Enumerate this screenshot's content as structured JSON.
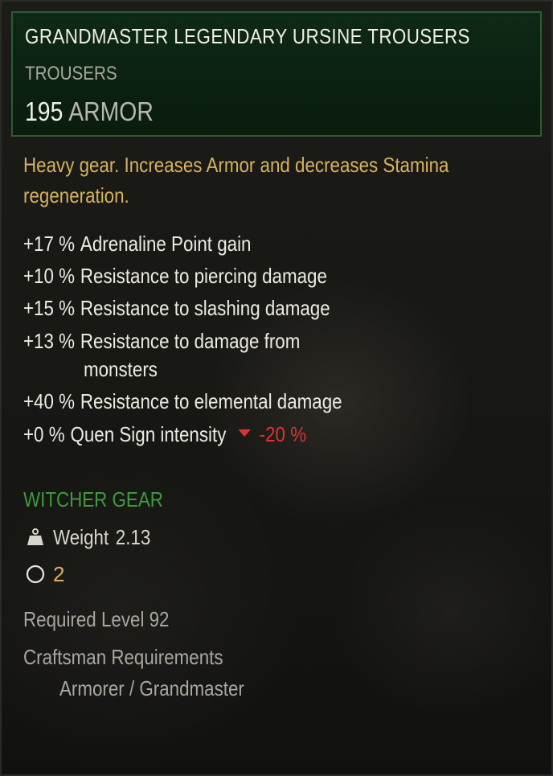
{
  "item": {
    "name": "GRANDMASTER LEGENDARY URSINE TROUSERS",
    "type": "TROUSERS",
    "armor_value": "195",
    "armor_label": "ARMOR"
  },
  "description": "Heavy gear. Increases Armor and decreases Stamina regeneration.",
  "stats": [
    {
      "pct": "+17 %",
      "label": "Adrenaline Point gain"
    },
    {
      "pct": "+10 %",
      "label": "Resistance to piercing damage"
    },
    {
      "pct": "+15 %",
      "label": "Resistance to slashing damage"
    },
    {
      "pct": "+13 %",
      "label": "Resistance to damage from",
      "continuation": "monsters"
    },
    {
      "pct": "+40 %",
      "label": "Resistance to elemental damage"
    },
    {
      "pct": "+0 %",
      "label": "Quen Sign intensity",
      "modifier": "-20 %",
      "modifier_icon": "red-down-triangle-icon"
    }
  ],
  "gear_tag": "WITCHER GEAR",
  "weight": {
    "icon": "weight-icon",
    "label": "Weight",
    "value": "2.13"
  },
  "slots": {
    "icon": "empty-slot-circle-icon",
    "count": "2"
  },
  "required_level": "Required Level 92",
  "craftsman": {
    "title": "Craftsman Requirements",
    "value": "Armorer / Grandmaster"
  },
  "colors": {
    "header_bg": "#0f2a16",
    "header_border": "#2f5a33",
    "description": "#d7b25e",
    "gear_tag": "#3f9a3c",
    "negative": "#e23232",
    "muted": "#a9a79e"
  }
}
